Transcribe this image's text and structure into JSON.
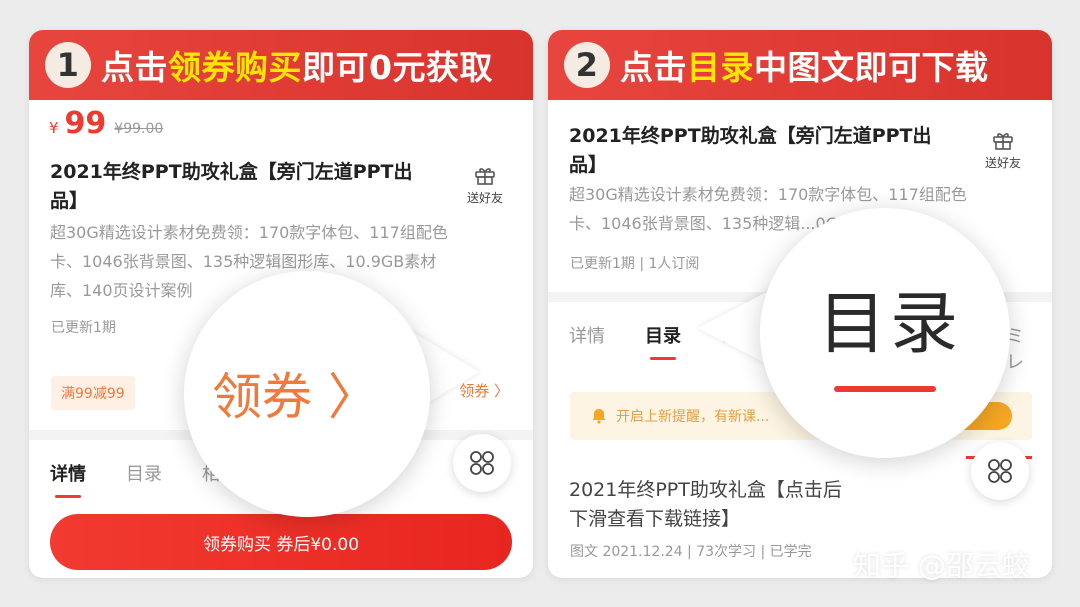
{
  "left": {
    "step_number": "1",
    "banner_prefix": "点击",
    "banner_highlight": "领券购买",
    "banner_suffix": "即可0元获取",
    "price_symbol": "¥",
    "price": "99",
    "original_price": "¥99.00",
    "title_line1": "2021年终PPT助攻礼盒【旁门左道PPT出",
    "title_line2": "品】",
    "gift_label": "送好友",
    "description_line1": "超30G精选设计素材免费领：170款字体包、117组配色",
    "description_line2": "卡、1046张背景图、135种逻辑图形库、10.9GB素材",
    "description_line3": "库、140页设计案例",
    "update_status": "已更新1期",
    "coupon_tag": "满99减99",
    "coupon_link": "领券 〉",
    "magnifier_text": "领券 〉",
    "tabs": [
      {
        "label": "详情",
        "active": true
      },
      {
        "label": "目录",
        "active": false
      },
      {
        "label": "相...",
        "active": false
      }
    ],
    "buy_button": "领券购买 券后¥0.00"
  },
  "right": {
    "step_number": "2",
    "banner_prefix": "点击",
    "banner_highlight": "目录",
    "banner_suffix": "中图文即可下载",
    "title_line1": "2021年终PPT助攻礼盒【旁门左道PPT出",
    "title_line2": "品】",
    "gift_label": "送好友",
    "description_line1": "超30G精选设计素材免费领：170款字体包、117组配色",
    "description_line2": "卡、1046张背景图、135种逻辑...0GB素材...",
    "meta": "已更新1期 | 1人订阅",
    "tabs": [
      {
        "label": "详情",
        "active": false
      },
      {
        "label": "目录",
        "active": true
      },
      {
        "label": "课堂互...",
        "active": false
      }
    ],
    "tab_cut": "ミレ",
    "magnifier_text": "目录",
    "notice_text": "开启上新提醒，有新课...",
    "article_title_line1": "2021年终PPT助攻礼盒【点击后",
    "article_title_line2": "下滑查看下载链接】",
    "article_meta": "图文  2021.12.24 | 73次学习 | 已学完"
  },
  "watermark": "知乎 @邵云蛟",
  "colors": {
    "banner_red": "#e8453f",
    "highlight_yellow": "#ffe600",
    "price_red": "#ee3a30",
    "coupon_orange": "#f07a3a"
  },
  "icons": [
    "gift-icon",
    "grid-menu-icon",
    "bell-icon"
  ]
}
